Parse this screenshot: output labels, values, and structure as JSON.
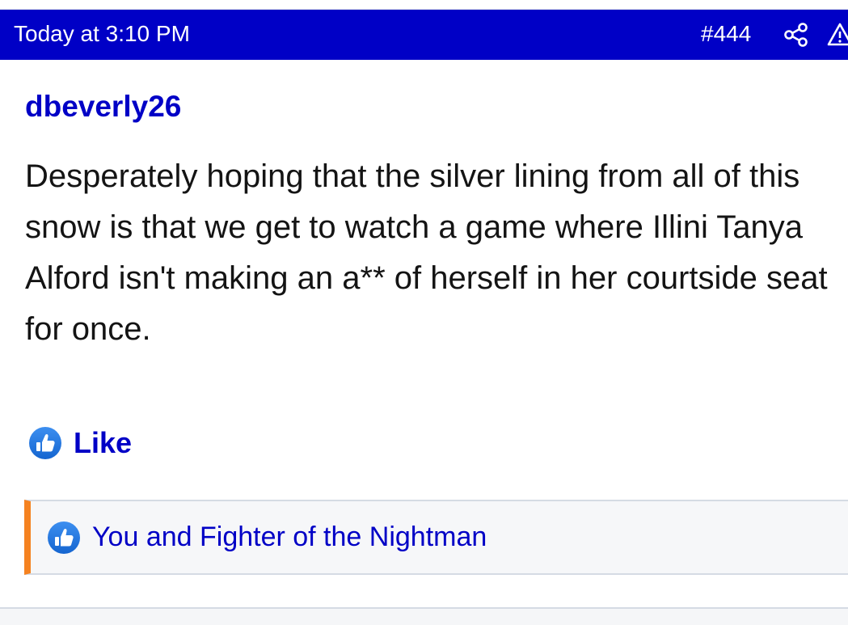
{
  "post": {
    "timestamp": "Today at 3:10 PM",
    "number": "#444",
    "author": "dbeverly26",
    "message": "Desperately hoping that the silver lining from all of this snow is that we get to watch a game where Illini Tanya Alford isn't making an a** of herself in her courtside seat for once."
  },
  "actions": {
    "like_label": "Like"
  },
  "reactions": {
    "summary": "You and Fighter of the Nightman"
  },
  "icons": {
    "share": "share-icon",
    "report": "warning-icon",
    "like": "thumbs-up-icon"
  },
  "colors": {
    "header_bg": "#0000c6",
    "link": "#0000c6",
    "accent": "#f58220",
    "like_icon": "#1f7ae0"
  }
}
